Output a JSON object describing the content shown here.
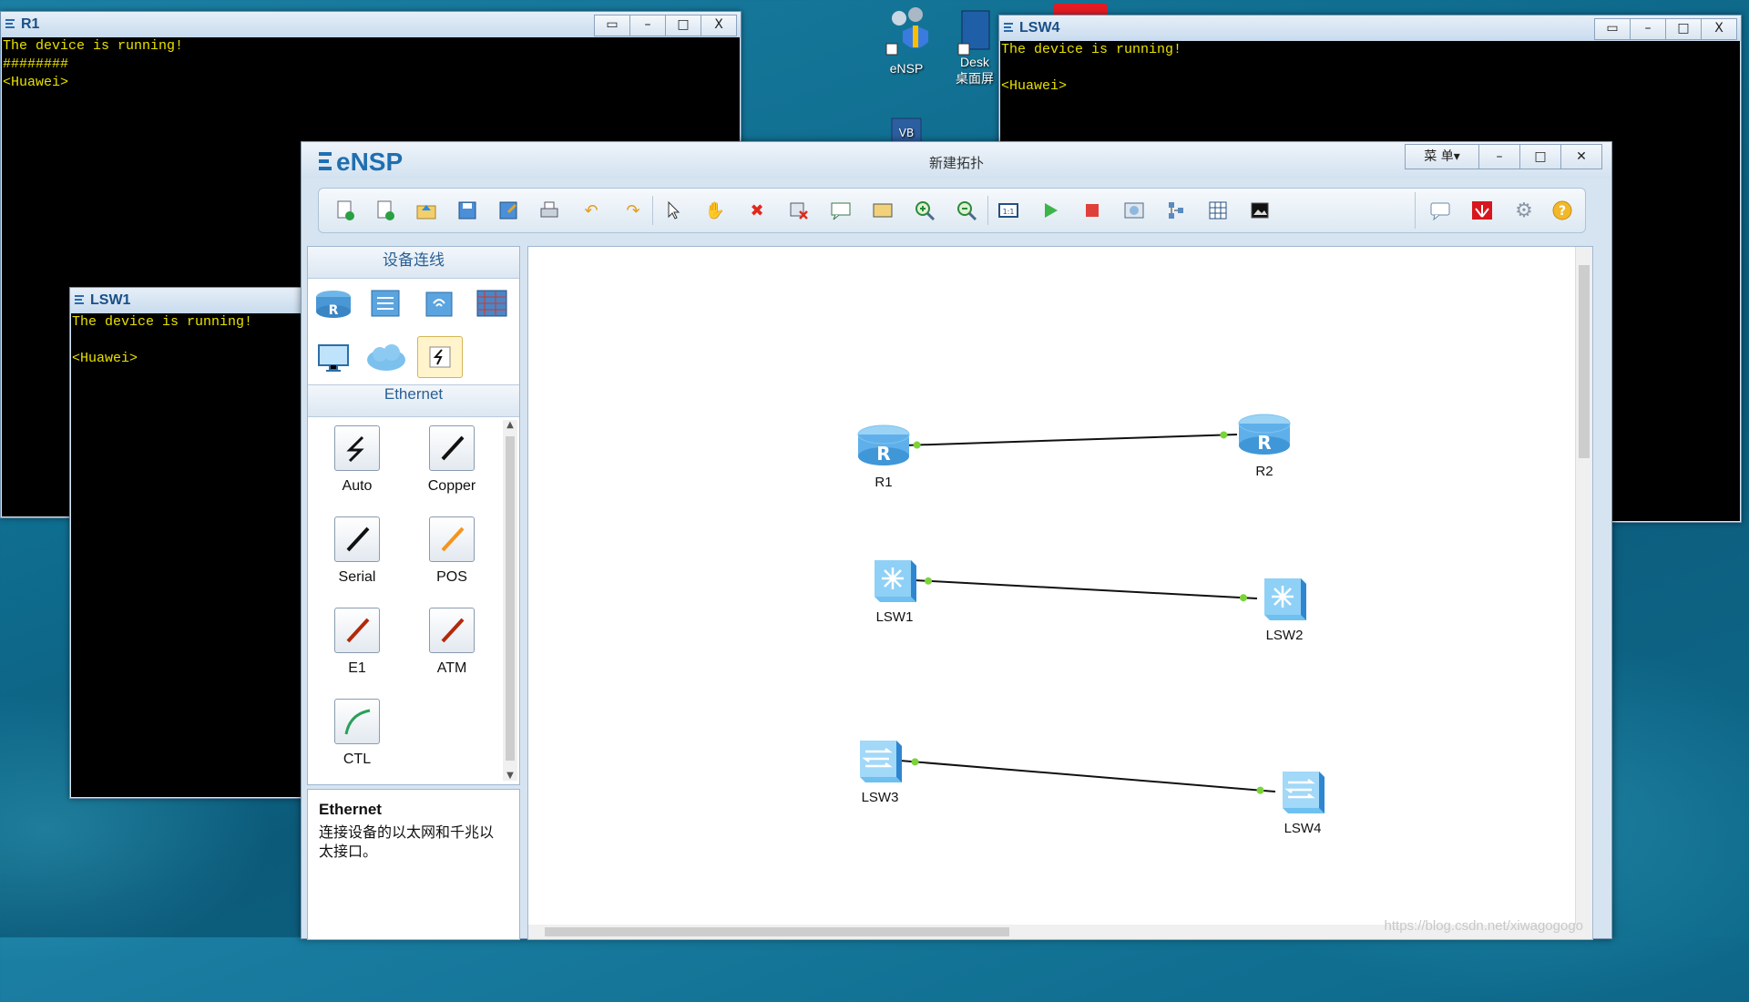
{
  "desktop": {
    "icons": [
      {
        "label": "eNSP"
      },
      {
        "label": "Desk"
      },
      {
        "label": "桌面屏"
      }
    ]
  },
  "consoles": {
    "r1": {
      "title": "R1",
      "lines": [
        "The device is running!",
        "########",
        "<Huawei>"
      ]
    },
    "lsw4": {
      "title": "LSW4",
      "lines": [
        "The device is running!",
        "",
        "<Huawei>"
      ]
    },
    "lsw1": {
      "title": "LSW1",
      "lines": [
        "The device is running!",
        "",
        "<Huawei>"
      ]
    },
    "buttons": {
      "restore": "▭",
      "minimize": "–",
      "maximize": "□",
      "close": "X"
    }
  },
  "ensp": {
    "logo": "eNSP",
    "window_title": "新建拓扑",
    "menu_label": "菜 单▾",
    "minimize": "–",
    "maximize": "□",
    "close": "✕"
  },
  "toolbar": {
    "icons": [
      "new-topology-icon",
      "new-blank-icon",
      "open-icon",
      "save-icon",
      "save-as-icon",
      "print-icon",
      "undo-icon",
      "redo-icon",
      "select-icon",
      "pan-hand-icon",
      "delete-icon",
      "delete-link-icon",
      "text-note-icon",
      "rectangle-icon",
      "zoom-in-icon",
      "zoom-out-icon",
      "fit-icon",
      "start-icon",
      "stop-icon",
      "capture-icon",
      "topology-icon",
      "grid-icon",
      "screenshot-icon"
    ],
    "right_icons": [
      "chat-icon",
      "huawei-logo-icon",
      "settings-icon",
      "help-icon"
    ]
  },
  "panel": {
    "header": "设备连线",
    "devices": [
      "router-icon",
      "switch-icon",
      "wlan-icon",
      "firewall-icon",
      "pc-icon",
      "cloud-icon",
      "cable-icon"
    ],
    "section": "Ethernet",
    "cables": [
      {
        "label": "Auto",
        "color": "#111111"
      },
      {
        "label": "Copper",
        "color": "#111111"
      },
      {
        "label": "Serial",
        "color": "#111111"
      },
      {
        "label": "POS",
        "color": "#f7941d"
      },
      {
        "label": "E1",
        "color": "#b22a0a"
      },
      {
        "label": "ATM",
        "color": "#b22a0a"
      },
      {
        "label": "CTL",
        "color": "#2aa05a"
      }
    ],
    "desc_title": "Ethernet",
    "desc_text": "连接设备的以太网和千兆以太接口。"
  },
  "topology": {
    "nodes": [
      {
        "label": "R1",
        "type": "router"
      },
      {
        "label": "R2",
        "type": "router"
      },
      {
        "label": "LSW1",
        "type": "l3switch"
      },
      {
        "label": "LSW2",
        "type": "l3switch"
      },
      {
        "label": "LSW3",
        "type": "l2switch"
      },
      {
        "label": "LSW4",
        "type": "l2switch"
      }
    ],
    "links": [
      [
        "R1",
        "R2"
      ],
      [
        "LSW1",
        "LSW2"
      ],
      [
        "LSW3",
        "LSW4"
      ]
    ],
    "link_dot_color": "#7bd33a"
  },
  "watermark": "https://blog.csdn.net/xiwagogogo"
}
